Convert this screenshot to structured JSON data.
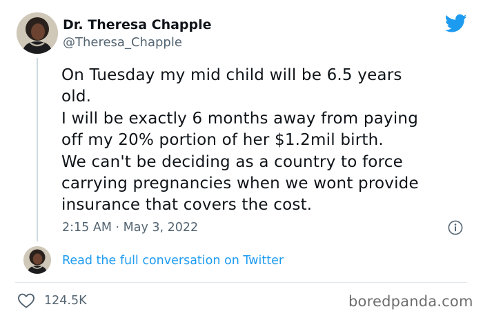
{
  "author": {
    "name": "Dr. Theresa Chapple",
    "handle": "@Theresa_Chapple"
  },
  "tweet": {
    "lines": [
      "On Tuesday my mid child will be 6.5 years",
      "old.",
      "I will be exactly 6 months away from paying",
      "off my 20% portion of her $1.2mil birth.",
      "We can't be deciding as a country to force",
      "carrying pregnancies when we wont provide",
      "insurance that covers the cost."
    ],
    "timestamp": "2:15 AM · May 3, 2022"
  },
  "conversation": {
    "link_text": "Read the full conversation on Twitter"
  },
  "engagement": {
    "likes": "124.5K"
  },
  "watermark": "boredpanda.com",
  "icons": {
    "brand": "twitter-bird-icon",
    "info": "info-icon",
    "like": "heart-icon"
  },
  "colors": {
    "brand_blue": "#1d9bf0",
    "text_primary": "#0f1419",
    "text_secondary": "#536471",
    "divider": "#e1e8ed"
  }
}
